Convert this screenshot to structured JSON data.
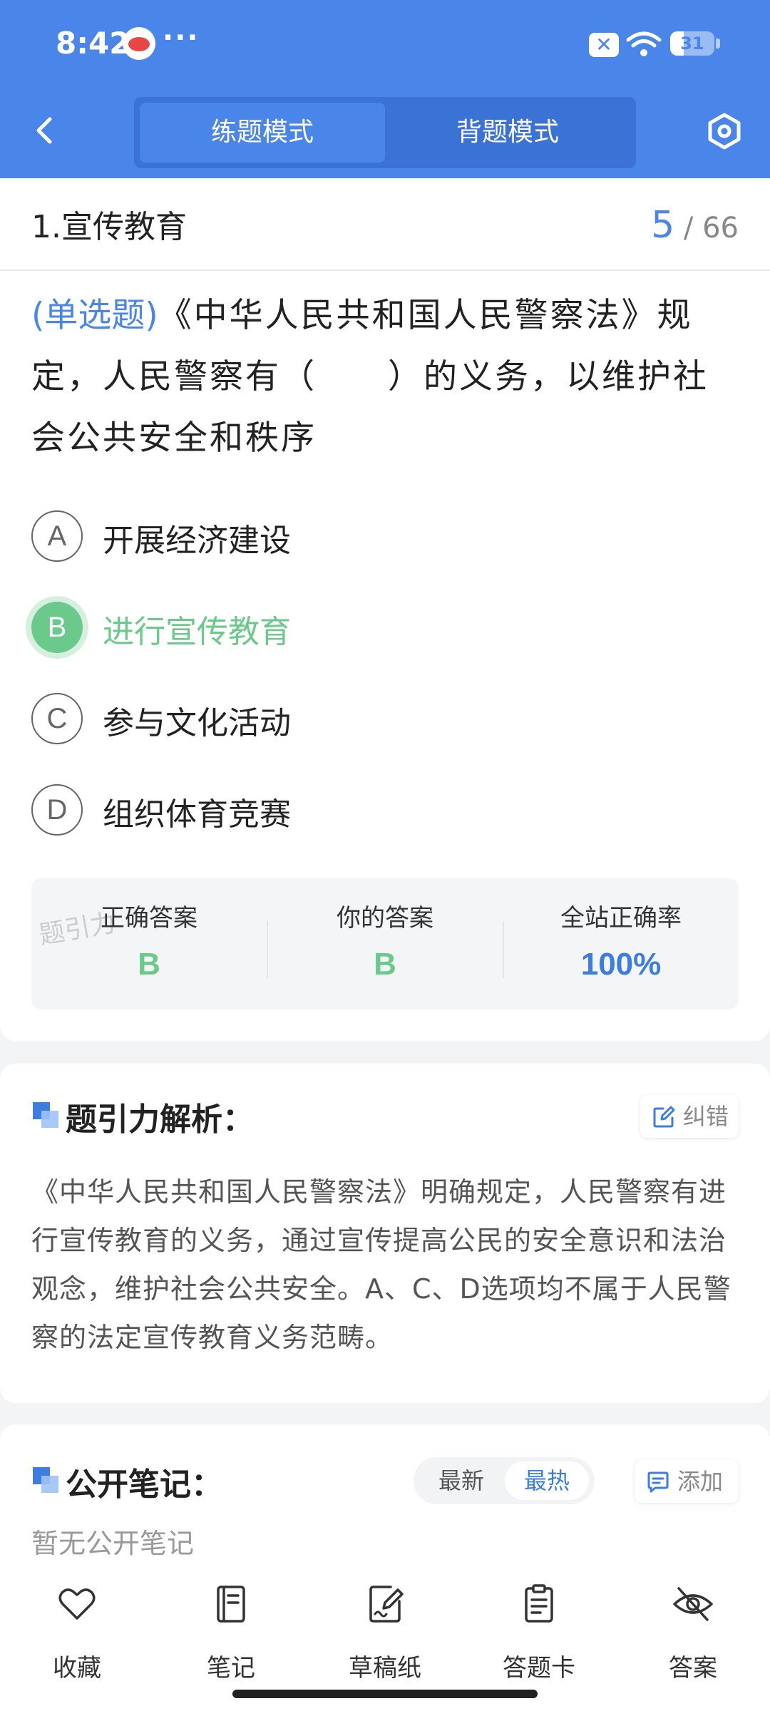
{
  "status": {
    "time": "8:42",
    "dots": "···",
    "battery": "31",
    "battery_level": 0.31
  },
  "header": {
    "mode_practice": "练题模式",
    "mode_recite": "背题模式"
  },
  "question_header": {
    "section": "1.宣传教育",
    "current": "5",
    "separator": "/",
    "total": "66"
  },
  "question": {
    "type": "(单选题)",
    "text": "《中华人民共和国人民警察法》规定，人民警察有（　　）的义务，以维护社会公共安全和秩序"
  },
  "options": [
    {
      "letter": "A",
      "text": "开展经济建设"
    },
    {
      "letter": "B",
      "text": "进行宣传教育"
    },
    {
      "letter": "C",
      "text": "参与文化活动"
    },
    {
      "letter": "D",
      "text": "组织体育竞赛"
    }
  ],
  "answer_box": {
    "watermark": "题引力",
    "correct_label": "正确答案",
    "correct_value": "B",
    "yours_label": "你的答案",
    "yours_value": "B",
    "rate_label": "全站正确率",
    "rate_value": "100%"
  },
  "analysis": {
    "title": "题引力解析：",
    "report_label": "纠错",
    "text": "《中华人民共和国人民警察法》明确规定，人民警察有进行宣传教育的义务，通过宣传提高公民的安全意识和法治观念，维护社会公共安全。A、C、D选项均不属于人民警察的法定宣传教育义务范畴。"
  },
  "notes": {
    "title": "公开笔记：",
    "sort_newest": "最新",
    "sort_hottest": "最热",
    "add_label": "添加",
    "empty_text": "暂无公开笔记"
  },
  "bottom_tabs": [
    {
      "label": "收藏",
      "icon": "heart-icon"
    },
    {
      "label": "笔记",
      "icon": "notebook-icon"
    },
    {
      "label": "草稿纸",
      "icon": "draft-paper-icon"
    },
    {
      "label": "答题卡",
      "icon": "answer-sheet-icon"
    },
    {
      "label": "答案",
      "icon": "eye-off-icon"
    }
  ],
  "colors": {
    "primary": "#4a86ea",
    "correct": "#6cc98c",
    "rate": "#3b7de0"
  }
}
